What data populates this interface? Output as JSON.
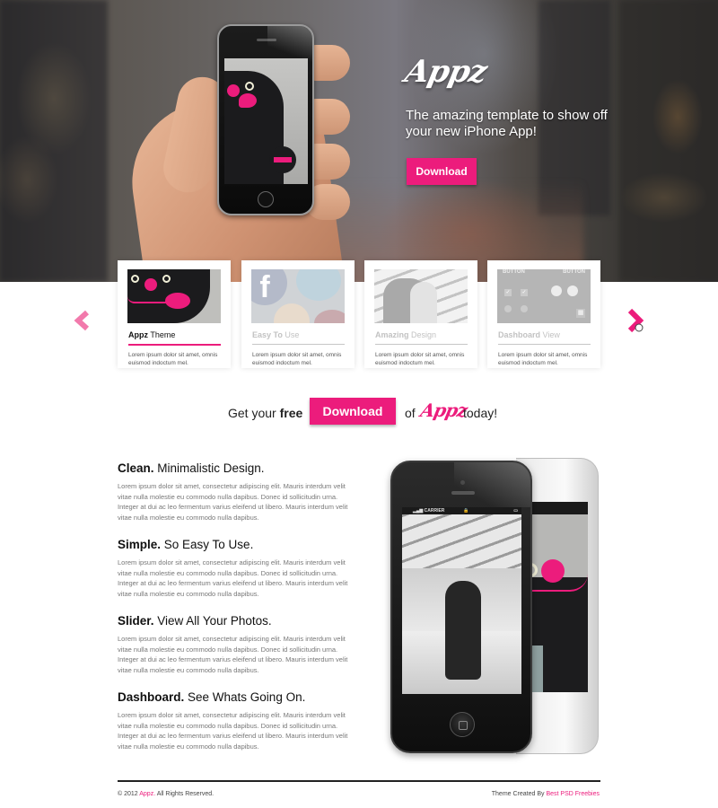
{
  "hero": {
    "logo": "Appz",
    "tagline": "The amazing template to show off your new iPhone App!",
    "download_label": "Download"
  },
  "slider": {
    "prev_icon": "chevron-left-icon",
    "next_icon": "chevron-right-icon",
    "cards": [
      {
        "title_bold": "Appz",
        "title_rest": " Theme",
        "description": "Lorem ipsum dolor sit amet, omnis euismod indoctum mel.",
        "active": true
      },
      {
        "title_bold": "Easy To",
        "title_rest": " Use",
        "description": "Lorem ipsum dolor sit amet, omnis euismod indoctum mel.",
        "active": false
      },
      {
        "title_bold": "Amazing",
        "title_rest": " Design",
        "description": "Lorem ipsum dolor sit amet, omnis euismod indoctum mel.",
        "active": false
      },
      {
        "title_bold": "Dashboard",
        "title_rest": " View",
        "description": "Lorem ipsum dolor sit amet, omnis euismod indoctum mel.",
        "active": false
      }
    ],
    "dashboard_thumb_labels": [
      "BUTTON",
      "BUTTON"
    ]
  },
  "cta": {
    "prefix": "Get your ",
    "prefix_bold": "free",
    "download_label": "Download",
    "of": "of",
    "logo": "Appz",
    "suffix": "today!"
  },
  "features": [
    {
      "title_bold": "Clean.",
      "title_rest": " Minimalistic Design.",
      "body": "Lorem ipsum dolor sit amet, consectetur adipiscing elit. Mauris interdum velit vitae nulla molestie eu commodo nulla dapibus. Donec id sollicitudin urna. Integer at dui ac leo fermentum varius eleifend ut libero. Mauris interdum velit vitae nulla molestie eu commodo nulla dapibus."
    },
    {
      "title_bold": "Simple.",
      "title_rest": " So Easy To Use.",
      "body": "Lorem ipsum dolor sit amet, consectetur adipiscing elit. Mauris interdum velit vitae nulla molestie eu commodo nulla dapibus. Donec id sollicitudin urna. Integer at dui ac leo fermentum varius eleifend ut libero. Mauris interdum velit vitae nulla molestie eu commodo nulla dapibus."
    },
    {
      "title_bold": "Slider.",
      "title_rest": " View All Your Photos.",
      "body": "Lorem ipsum dolor sit amet, consectetur adipiscing elit. Mauris interdum velit vitae nulla molestie eu commodo nulla dapibus. Donec id sollicitudin urna. Integer at dui ac leo fermentum varius eleifend ut libero. Mauris interdum velit vitae nulla molestie eu commodo nulla dapibus."
    },
    {
      "title_bold": "Dashboard.",
      "title_rest": " See Whats Going On.",
      "body": "Lorem ipsum dolor sit amet, consectetur adipiscing elit. Mauris interdum velit vitae nulla molestie eu commodo nulla dapibus. Donec id sollicitudin urna. Integer at dui ac leo fermentum varius eleifend ut libero. Mauris interdum velit vitae nulla molestie eu commodo nulla dapibus."
    }
  ],
  "showcase": {
    "status_carrier": "CARRIER"
  },
  "footer": {
    "copyright_prefix": "© 2012 ",
    "copyright_link": "Appz.",
    "copyright_suffix": " All Rights Reserved.",
    "credit_prefix": "Theme Created By ",
    "credit_link": "Best PSD Freebies"
  },
  "colors": {
    "accent": "#ec1c7c",
    "text": "#222222",
    "muted": "#777777"
  }
}
